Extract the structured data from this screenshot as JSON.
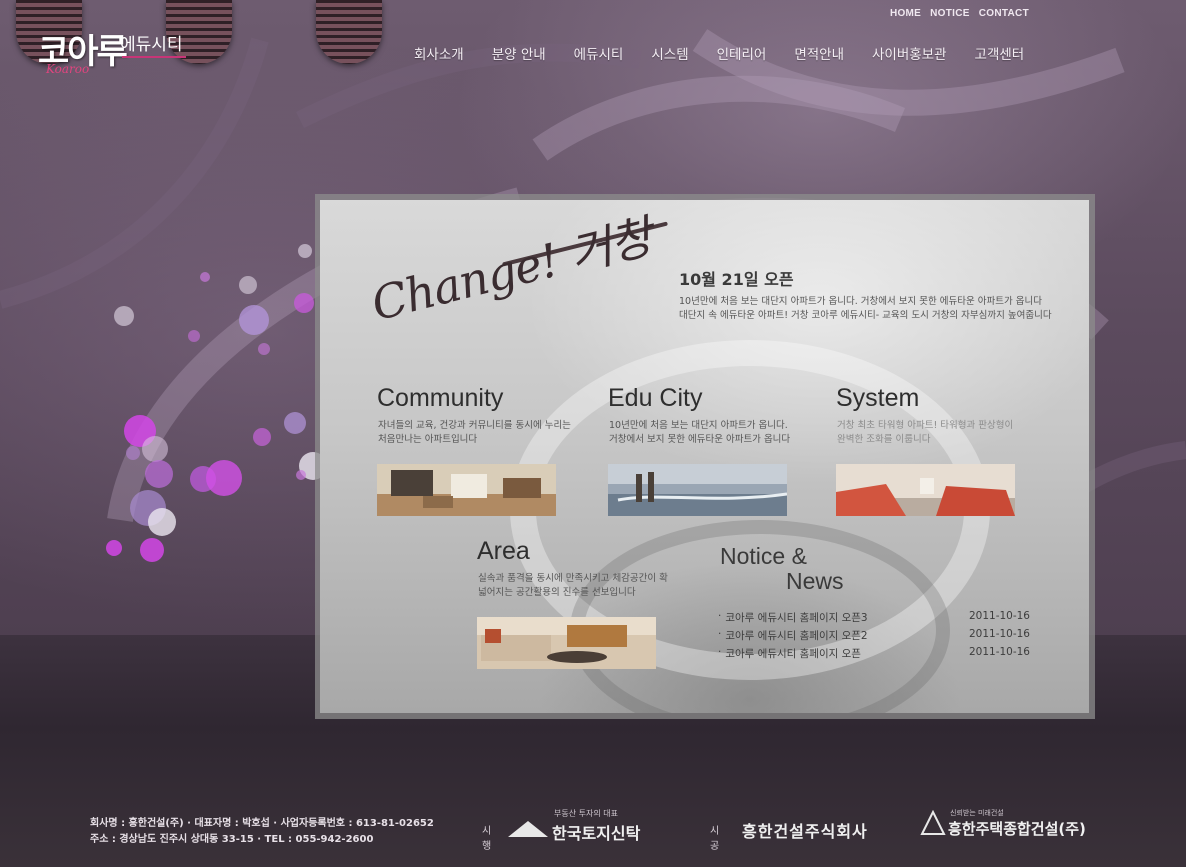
{
  "header": {
    "logo_text": "코아루",
    "logo_sub": "에듀시티",
    "logo_en": "Koaroo",
    "top_links": [
      "HOME",
      "NOTICE",
      "CONTACT"
    ],
    "nav": [
      "회사소개",
      "분양 안내",
      "에듀시티",
      "시스템",
      "인테리어",
      "면적안내",
      "사이버홍보관",
      "고객센터"
    ]
  },
  "panel": {
    "hero_script": "Change! 거창",
    "open_title": "10월 21일 오픈",
    "open_desc": [
      "10년만에 처음 보는 대단지 아파트가 옵니다. 거창에서 보지 못한 에듀타운 아파트가 옵니다",
      "대단지 속 에듀타운 아파트! 거창 코아루 에듀시티- 교육의 도시 거창의 자부심까지 높여줍니다"
    ],
    "community": {
      "title": "Community",
      "desc": [
        "자녀들의 교육, 건강과 커뮤니티를 동시에 누리는",
        "처음만나는 아파트입니다"
      ]
    },
    "educity": {
      "title": "Edu City",
      "desc": [
        "10년만에 처음 보는 대단지 아파트가 옵니다.",
        "거창에서 보지 못한 에듀타운 아파트가 옵니다"
      ]
    },
    "system": {
      "title": "System",
      "desc": [
        "거창 최초 타워형 아파트! 타워형과 판상형이",
        "완벽한 조화를 이룹니다"
      ]
    },
    "area": {
      "title": "Area",
      "desc": [
        "실속과 품격을 동시에 만족시키고 체감공간이 확",
        "넓어지는 공간활용의 진수를 선보입니다"
      ]
    },
    "notice": {
      "title_line1": "Notice &",
      "title_line2": "News",
      "items": [
        {
          "title": "코아루 에듀시티 홈페이지 오픈3",
          "date": "2011-10-16"
        },
        {
          "title": "코아루 에듀시티 홈페이지 오픈2",
          "date": "2011-10-16"
        },
        {
          "title": "코아루 에듀시티 홈페이지 오픈",
          "date": "2011-10-16"
        }
      ]
    }
  },
  "footer": {
    "line1": "회사명 : 흥한건설(주)  ·  대표자명 : 박호섭  ·  사업자등록번호 : 613-81-02652",
    "line2": "주소 :  경상남도 진주시 상대동 33-15  ·  TEL : 055-942-2600",
    "sihaeng_label": "시행",
    "sihaeng_small": "부동산 투자의 대표",
    "sihaeng_name": "한국토지신탁",
    "sigong_label": "시공",
    "sigong_name1": "흥한건설주식회사",
    "sigong_small": "신뢰받는 미래건설",
    "sigong_name2": "흥한주택종합건설(주)"
  },
  "colors": {
    "accent_pink": "#c83577",
    "bubble_purple": "#c04bd6"
  }
}
